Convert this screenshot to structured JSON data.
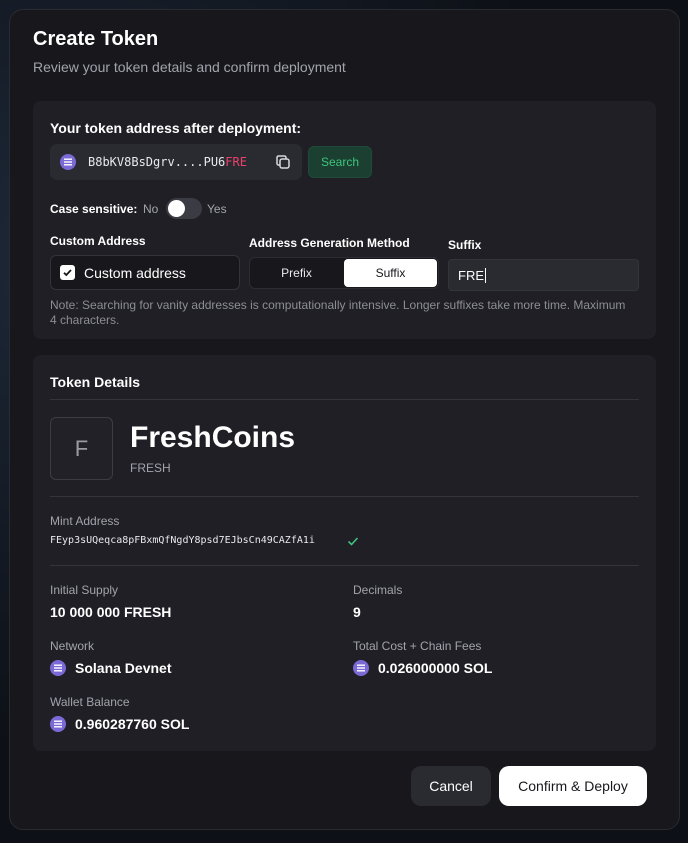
{
  "modal": {
    "title": "Create Token",
    "subtitle": "Review your token details and confirm deployment"
  },
  "address_section": {
    "heading": "Your token address after deployment:",
    "address_prefix": "B8bKV8BsDgrv....PU6",
    "address_suffix": "FRE",
    "search_label": "Search",
    "case_sensitive_label": "Case sensitive:",
    "case_no": "No",
    "case_yes": "Yes",
    "case_sensitive_on": false,
    "custom_address_label": "Custom Address",
    "custom_address_checkbox": "Custom address",
    "custom_address_checked": true,
    "method_label": "Address Generation Method",
    "method_options": [
      "Prefix",
      "Suffix"
    ],
    "method_selected": "Suffix",
    "suffix_label": "Suffix",
    "suffix_value": "FRE",
    "note": "Note: Searching for vanity addresses is computationally intensive. Longer suffixes take more time. Maximum 4 characters."
  },
  "details": {
    "heading": "Token Details",
    "avatar_letter": "F",
    "token_name": "FreshCoins",
    "token_symbol": "FRESH",
    "mint_label": "Mint Address",
    "mint_address": "FEyp3sUQeqca8pFBxmQfNgdY8psd7EJbsCn49CAZfA1i",
    "initial_supply_label": "Initial Supply",
    "initial_supply": "10 000 000 FRESH",
    "decimals_label": "Decimals",
    "decimals": "9",
    "network_label": "Network",
    "network": "Solana Devnet",
    "total_cost_label": "Total Cost + Chain Fees",
    "total_cost": "0.026000000 SOL",
    "wallet_label": "Wallet Balance",
    "wallet_balance": "0.960287760 SOL"
  },
  "footer": {
    "cancel_label": "Cancel",
    "confirm_label": "Confirm & Deploy"
  },
  "colors": {
    "accent_green": "#3ec47e",
    "suffix_highlight": "#e8436a",
    "solana_purple": "#7b6ad6"
  },
  "icons": {
    "solana": "solana-icon",
    "copy": "copy-icon",
    "check": "check-icon"
  }
}
